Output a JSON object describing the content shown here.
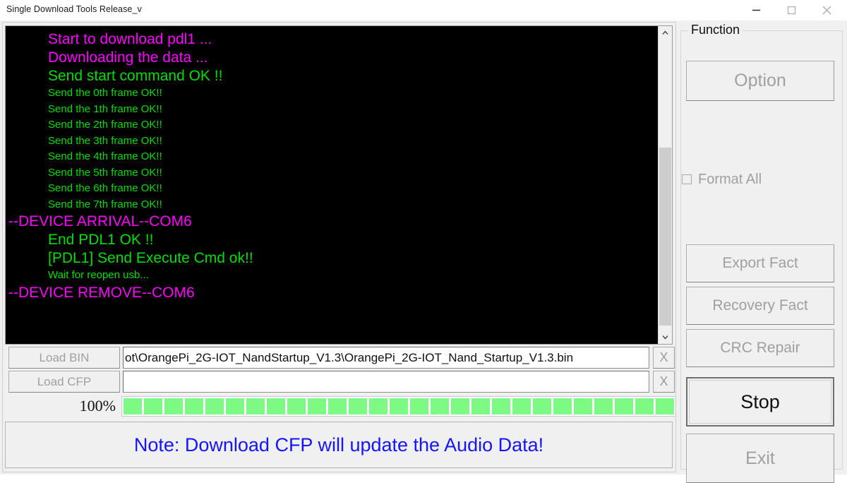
{
  "window": {
    "title": "Single Download Tools Release_v",
    "controls": {
      "minimize": "minimize-icon",
      "maximize": "maximize-icon",
      "close": "close-icon"
    }
  },
  "console": {
    "lines": [
      {
        "text": "Start to download pdl1 ...",
        "color": "#ff00ff",
        "size": "big",
        "indent": "indent"
      },
      {
        "text": "Downloading the data ...",
        "color": "#ff00ff",
        "size": "big",
        "indent": "indent"
      },
      {
        "text": "Send start command OK !!",
        "color": "#00e000",
        "size": "big",
        "indent": "indent"
      },
      {
        "text": "Send the 0th frame OK!!",
        "color": "#00e000",
        "size": "small",
        "indent": "indent"
      },
      {
        "text": "Send the 1th frame OK!!",
        "color": "#00e000",
        "size": "small",
        "indent": "indent"
      },
      {
        "text": "Send the 2th frame OK!!",
        "color": "#00e000",
        "size": "small",
        "indent": "indent"
      },
      {
        "text": "Send the 3th frame OK!!",
        "color": "#00e000",
        "size": "small",
        "indent": "indent"
      },
      {
        "text": "Send the 4th frame OK!!",
        "color": "#00e000",
        "size": "small",
        "indent": "indent"
      },
      {
        "text": "Send the 5th frame OK!!",
        "color": "#00e000",
        "size": "small",
        "indent": "indent"
      },
      {
        "text": "Send the 6th frame OK!!",
        "color": "#00e000",
        "size": "small",
        "indent": "indent"
      },
      {
        "text": "Send the 7th frame OK!!",
        "color": "#00e000",
        "size": "small",
        "indent": "indent"
      },
      {
        "text": "--DEVICE ARRIVAL--COM6",
        "color": "#ff00ff",
        "size": "dev",
        "indent": "none"
      },
      {
        "text": "End PDL1 OK !!",
        "color": "#00e000",
        "size": "big",
        "indent": "indent"
      },
      {
        "text": "[PDL1] Send Execute Cmd ok!!",
        "color": "#00e000",
        "size": "big",
        "indent": "indent"
      },
      {
        "text": "Wait for reopen usb...",
        "color": "#00e000",
        "size": "small",
        "indent": "indent"
      },
      {
        "text": "--DEVICE REMOVE--COM6",
        "color": "#ff00ff",
        "size": "dev",
        "indent": "none"
      }
    ],
    "scrollbar": {
      "up_arrow": "chevron-up-icon",
      "down_arrow": "chevron-down-icon"
    }
  },
  "files": {
    "bin": {
      "button_label": "Load BIN",
      "path": "ot\\OrangePi_2G-IOT_NandStartup_V1.3\\OrangePi_2G-IOT_Nand_Startup_V1.3.bin",
      "placeholder": "",
      "clear_label": "X"
    },
    "cfp": {
      "button_label": "Load CFP",
      "path": "",
      "placeholder": "",
      "clear_label": "X"
    }
  },
  "progress": {
    "percent_label": "100%",
    "value": 100,
    "segments": 30,
    "color": "#7cfa84"
  },
  "note": {
    "text": "Note: Download CFP will update the Audio Data!",
    "color": "#1414ff"
  },
  "function_panel": {
    "legend": "Function",
    "option_button": "Option",
    "format_all": {
      "label": "Format All",
      "checked": false
    },
    "buttons": [
      {
        "label": "Export Fact",
        "enabled": false
      },
      {
        "label": "Recovery Fact",
        "enabled": false
      },
      {
        "label": "CRC Repair",
        "enabled": false
      },
      {
        "label": "Stop",
        "enabled": true
      },
      {
        "label": "Exit",
        "enabled": false
      }
    ]
  }
}
